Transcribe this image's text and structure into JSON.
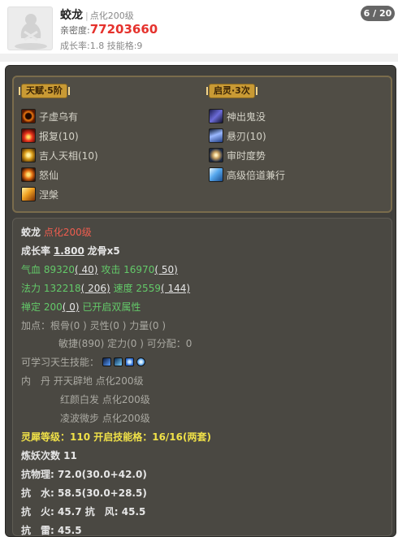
{
  "header": {
    "name": "蛟龙",
    "separator": "|",
    "level": "点化200级",
    "intimacy_label": "亲密度:",
    "intimacy_value": "77203660",
    "growth_line": "成长率:1.8  技能格:9",
    "page_indicator": "6 / 20"
  },
  "talent": {
    "title": "天赋·5阶",
    "skills": [
      "子虚乌有",
      "报复(10)",
      "吉人天相(10)",
      "怒仙",
      "涅槃"
    ]
  },
  "awaken": {
    "title": "启灵·3次",
    "skills": [
      "神出鬼没",
      "悬刃(10)",
      "审时度势",
      "高级倍道兼行"
    ]
  },
  "detail": {
    "name": "蛟龙",
    "level": "点化200级",
    "growth_label": "成长率",
    "growth_value": "1.800",
    "dragon_bone": "龙骨x5",
    "hp_label": "气血",
    "hp_value": "89320",
    "hp_bonus": "( 40)",
    "atk_label": "攻击",
    "atk_value": "16970",
    "atk_bonus": "( 50)",
    "mp_label": "法力",
    "mp_value": "132218",
    "mp_bonus": "( 206)",
    "spd_label": "速度",
    "spd_value": "2559",
    "spd_bonus": "( 144)",
    "zen_label": "禅定",
    "zen_value": "200",
    "zen_bonus": "( 0)",
    "zen_note": "已开启双属性",
    "points_line1": "加点：根骨(0 ) 灵性(0 ) 力量(0 )",
    "points_line2": "敏捷(890) 定力(0 ) 可分配：0",
    "learnable_label": "可学习天生技能：",
    "dan_label": "内　丹",
    "dan_items": [
      "开天辟地 点化200级",
      "红颜白发 点化200级",
      "凌波微步 点化200级"
    ],
    "spirit_line": "灵犀等级：110 开启技能格：16/16(两套)",
    "demon_line": "炼妖次数 11",
    "res_phys": "抗物理: 72.0(30.0+42.0)",
    "res_water": "抗　水: 58.5(30.0+28.5)",
    "res_fire_wind": "抗　火: 45.7 抗　风: 45.5",
    "res_thunder": "抗　雷: 45.5"
  },
  "colors": {
    "intimacy": "#e5322d",
    "badge": "#666666",
    "panel": "#41403c",
    "gold": "#c99a34",
    "green": "#63c969",
    "red": "#ef5d4f",
    "yellow": "#f0e148"
  },
  "icons": {
    "talent": [
      "ring-of-fire-icon",
      "fire-splash-icon",
      "golden-aura-icon",
      "fire-spirit-icon",
      "phoenix-flame-icon"
    ],
    "awaken": [
      "shadow-glyph-icon",
      "blade-icon",
      "eye-vortex-icon",
      "wind-wing-icon"
    ],
    "learnable": [
      "blue-rune-icon",
      "water-wave-icon",
      "blue-spiral-icon",
      "blue-orb-icon"
    ]
  }
}
